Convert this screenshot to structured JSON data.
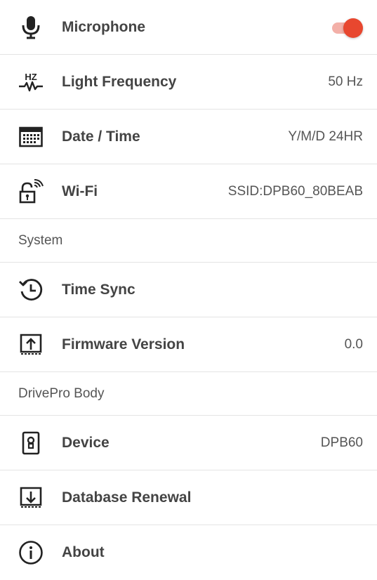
{
  "settings": {
    "microphone": {
      "label": "Microphone",
      "enabled": true,
      "icon": "microphone-icon"
    },
    "light_frequency": {
      "label": "Light Frequency",
      "value": "50 Hz",
      "icon": "hz-icon",
      "icon_text": "HZ"
    },
    "date_time": {
      "label": "Date / Time",
      "value": "Y/M/D 24HR",
      "icon": "calendar-icon"
    },
    "wifi": {
      "label": "Wi-Fi",
      "value": "SSID:DPB60_80BEAB",
      "icon": "wifi-lock-icon"
    }
  },
  "system": {
    "header": "System",
    "time_sync": {
      "label": "Time Sync",
      "icon": "clock-sync-icon"
    },
    "firmware": {
      "label": "Firmware Version",
      "value": "0.0",
      "icon": "upload-icon"
    }
  },
  "drivepro_body": {
    "header": "DrivePro Body",
    "device": {
      "label": "Device",
      "value": "DPB60",
      "icon": "device-icon"
    },
    "database": {
      "label": "Database Renewal",
      "icon": "download-icon"
    },
    "about": {
      "label": "About",
      "icon": "info-icon"
    }
  },
  "colors": {
    "accent": "#e8472f",
    "toggle_track": "#f3b0a8",
    "divider": "#e4e4e4"
  }
}
